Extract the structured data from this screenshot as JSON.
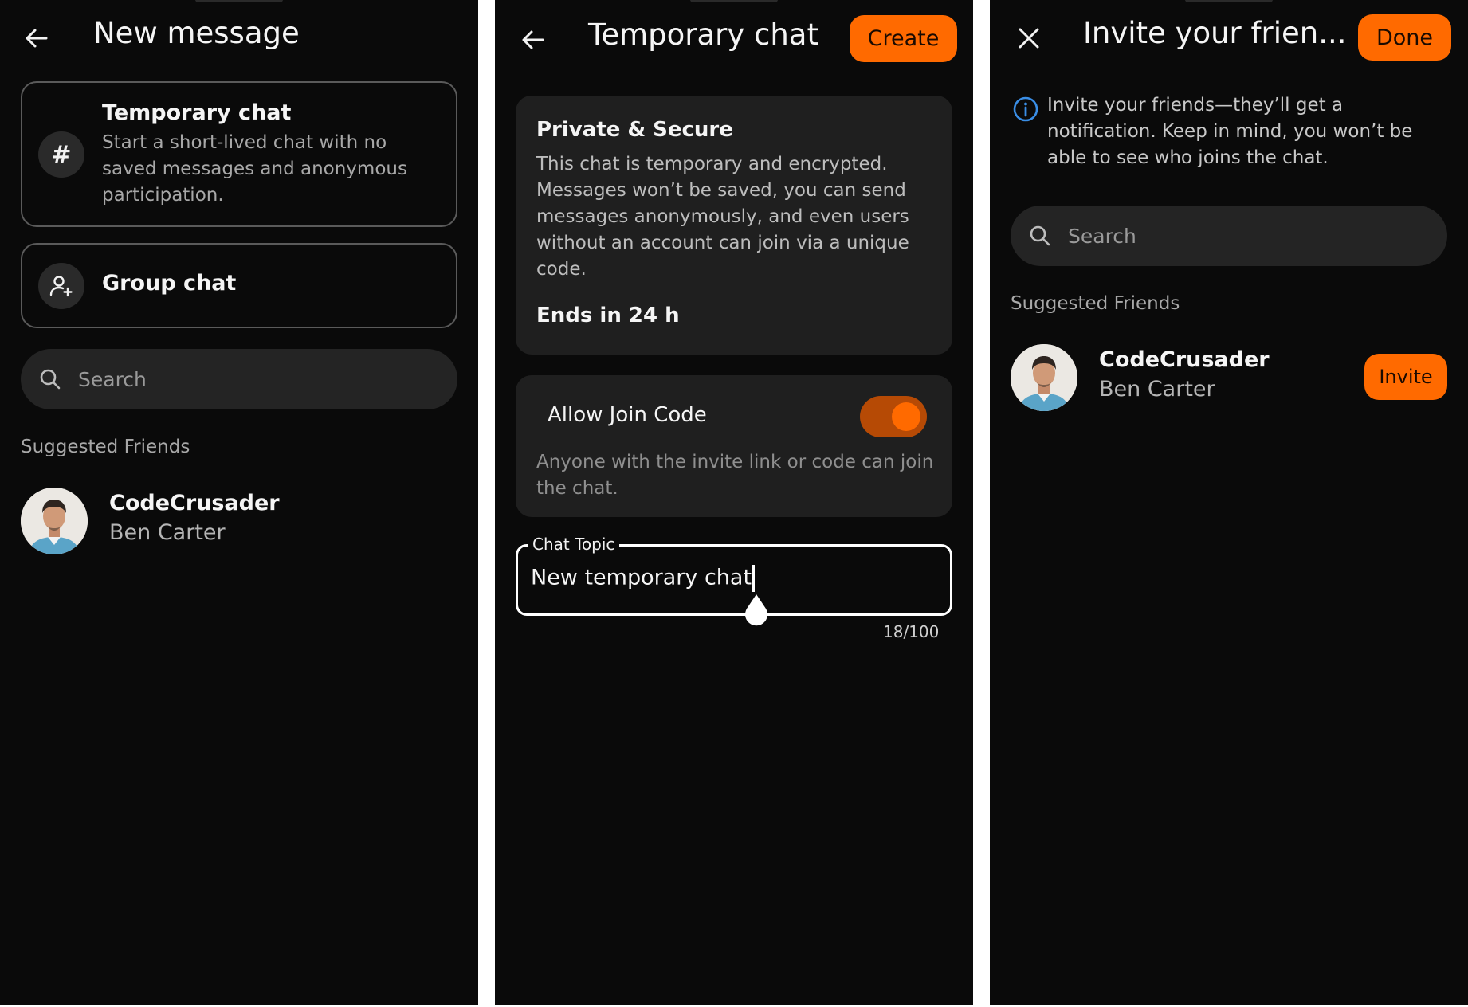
{
  "screen1": {
    "title": "New message",
    "temp_option": {
      "title": "Temporary chat",
      "desc": "Start a short-lived chat with no saved messages and anonymous participation.",
      "icon": "hash-icon"
    },
    "group_option": {
      "title": "Group chat",
      "icon": "add-person-icon"
    },
    "search_placeholder": "Search",
    "suggested_label": "Suggested Friends",
    "friend": {
      "name": "CodeCrusader",
      "username": "Ben Carter"
    }
  },
  "screen2": {
    "title": "Temporary chat",
    "create_label": "Create",
    "info_card": {
      "title": "Private & Secure",
      "body": "This chat is temporary and encrypted. Messages won’t be saved, you can send messages anonymously, and even users without an account can join via a unique code.",
      "ends": "Ends in 24 h"
    },
    "join_code": {
      "label": "Allow Join Code",
      "enabled": true,
      "desc": "Anyone with the invite link or code can join the chat."
    },
    "topic": {
      "label": "Chat Topic",
      "value": "New temporary chat",
      "counter": "18/100"
    }
  },
  "screen3": {
    "title": "Invite your frien...",
    "done_label": "Done",
    "info_text": "Invite your friends—they’ll get a notification. Keep in mind, you won’t be able to see who joins the chat.",
    "search_placeholder": "Search",
    "suggested_label": "Suggested Friends",
    "friend": {
      "name": "CodeCrusader",
      "username": "Ben Carter",
      "invite_label": "Invite"
    }
  },
  "colors": {
    "accent": "#ff6a00",
    "background": "#0a0a0a",
    "card": "#1f1f1f",
    "info_icon": "#3a8ee6"
  }
}
